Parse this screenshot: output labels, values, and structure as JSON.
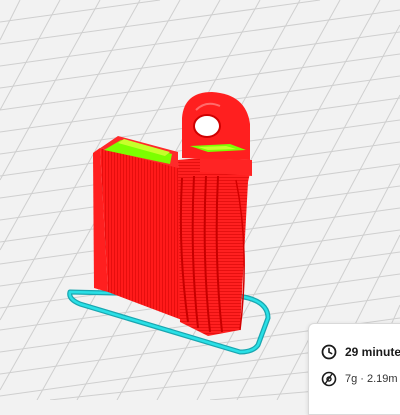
{
  "print_summary": {
    "time_label": "29 minute",
    "material_label": "7g · 2.19m ·"
  },
  "colors": {
    "model_wall": "#ff1a1a",
    "model_top": "#7cff00",
    "skirt": "#22d8d8",
    "grid_bg": "#f2f2f2",
    "grid_line": "#cfcfcf"
  },
  "icons": [
    "clock-icon",
    "filament-spool-icon"
  ]
}
